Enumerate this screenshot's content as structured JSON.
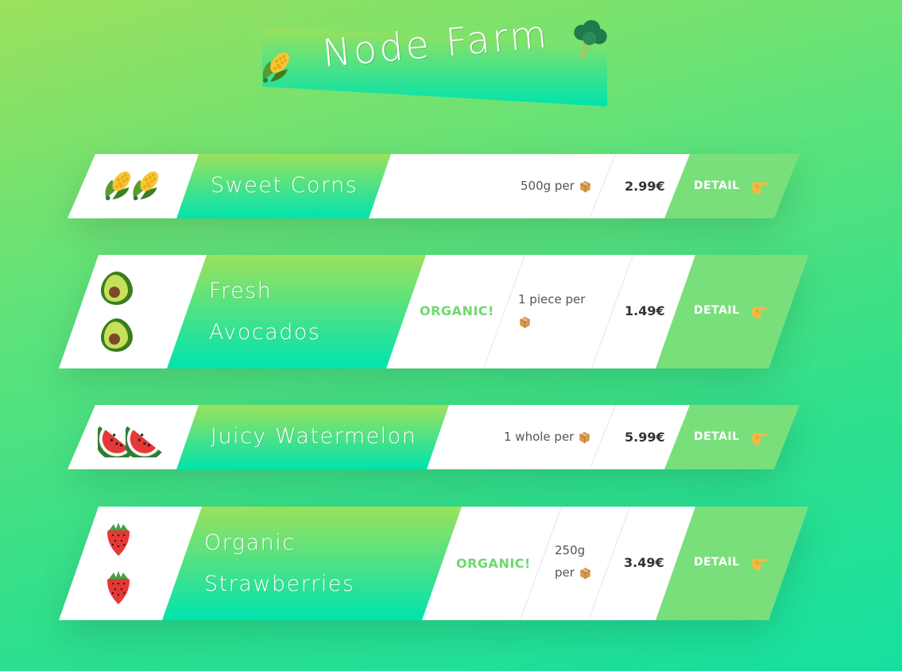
{
  "app": {
    "title": "Node Farm"
  },
  "colors": {
    "accent": "#79df7b",
    "organic": "#6fd86f",
    "gradient_top": "#9be15d",
    "gradient_bottom": "#00e3ae"
  },
  "title_icons": {
    "left": "corn-icon",
    "right": "broccoli-icon"
  },
  "products": [
    {
      "name": "Sweet Corns",
      "icon": "corn-icon",
      "organic": "",
      "quantity": "500g per",
      "quantity_icon": "package-icon",
      "price": "2.99€",
      "detail": "DETAIL",
      "detail_icon": "pointing-hand-icon"
    },
    {
      "name_line1": "Fresh",
      "name_line2": "Avocados",
      "icon": "avocado-icon",
      "organic": "ORGANIC!",
      "quantity_line1": "1 piece per",
      "quantity_icon": "package-icon",
      "price": "1.49€",
      "detail": "DETAIL",
      "detail_icon": "pointing-hand-icon"
    },
    {
      "name": "Juicy Watermelon",
      "icon": "watermelon-icon",
      "organic": "",
      "quantity": "1 whole per",
      "quantity_icon": "package-icon",
      "price": "5.99€",
      "detail": "DETAIL",
      "detail_icon": "pointing-hand-icon"
    },
    {
      "name_line1": "Organic",
      "name_line2": "Strawberries",
      "icon": "strawberry-icon",
      "organic": "ORGANIC!",
      "quantity_line1": "250g",
      "quantity_line2": "per",
      "quantity_icon": "package-icon",
      "price": "3.49€",
      "detail": "DETAIL",
      "detail_icon": "pointing-hand-icon"
    }
  ]
}
